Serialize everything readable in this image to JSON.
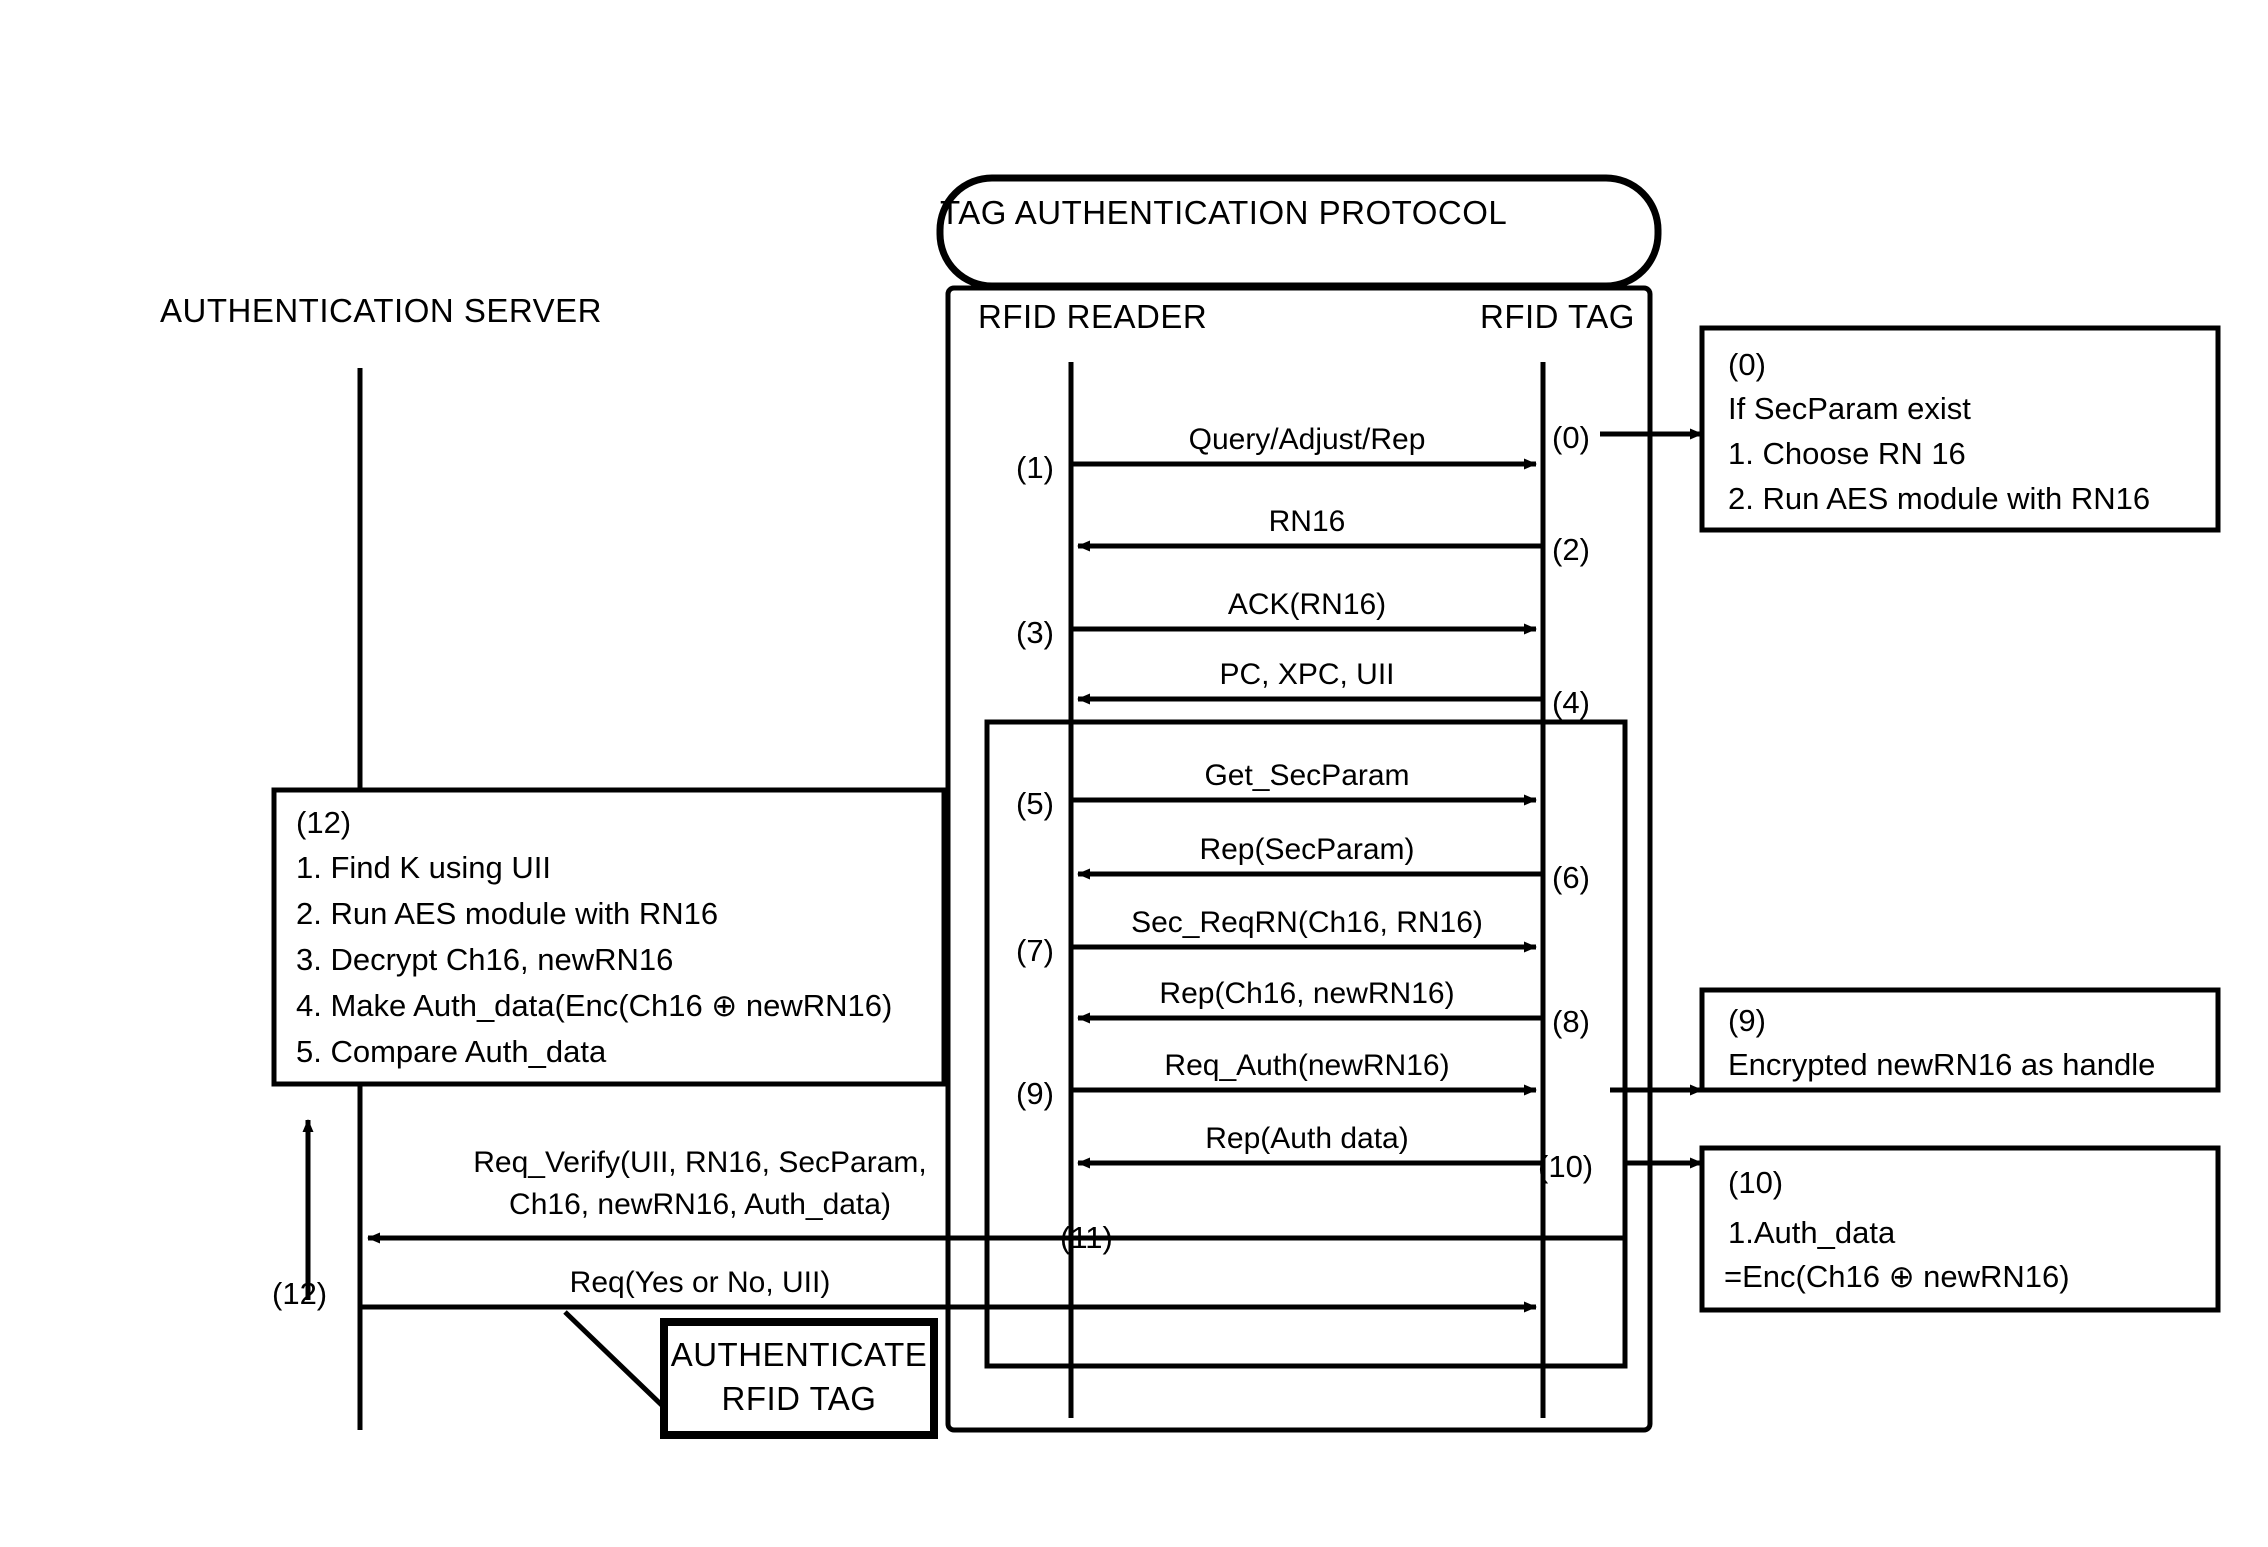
{
  "diagram": {
    "title": "TAG AUTHENTICATION PROTOCOL",
    "type": "sequence-diagram"
  },
  "lifelines": {
    "server": "AUTHENTICATION SERVER",
    "reader": "RFID READER",
    "tag": "RFID TAG"
  },
  "steps": {
    "s0": "(0)",
    "s1": "(1)",
    "s2": "(2)",
    "s3": "(3)",
    "s4": "(4)",
    "s5": "(5)",
    "s6": "(6)",
    "s7": "(7)",
    "s8": "(8)",
    "s9": "(9)",
    "s10": "(10)",
    "s11": "(11)",
    "s12": "(12)",
    "s12b": "(12)"
  },
  "messages": {
    "m1": "Query/Adjust/Rep",
    "m2": "RN16",
    "m3": "ACK(RN16)",
    "m4": "PC, XPC, UII",
    "m5": "Get_SecParam",
    "m6": "Rep(SecParam)",
    "m7": "Sec_ReqRN(Ch16, RN16)",
    "m8": "Rep(Ch16, newRN16)",
    "m9": "Req_Auth(newRN16)",
    "m10": "Rep(Auth data)",
    "m11_line1": "Req_Verify(UII, RN16, SecParam,",
    "m11_line2": "Ch16, newRN16, Auth_data)",
    "m12": "Req(Yes or No, UII)"
  },
  "note_zero": {
    "tag": "(0)",
    "l1": "If SecParam exist",
    "l2": "1. Choose RN 16",
    "l3": "2. Run AES module with RN16"
  },
  "note_nine": {
    "tag": "(9)",
    "l1": "Encrypted newRN16 as handle"
  },
  "note_ten": {
    "tag": "(10)",
    "l1": "1.Auth_data",
    "l2": "=Enc(Ch16 ⊕ newRN16)"
  },
  "note_twelve": {
    "tag": "(12)",
    "l1": "1. Find K using UII",
    "l2": "2. Run AES module with RN16",
    "l3": "3. Decrypt Ch16, newRN16",
    "l4": "4. Make Auth_data(Enc(Ch16 ⊕ newRN16)",
    "l5": "5. Compare Auth_data"
  },
  "result_box": {
    "l1": "AUTHENTICATE",
    "l2": "RFID TAG"
  },
  "colors": {
    "stroke": "#000000",
    "background": "#ffffff"
  }
}
